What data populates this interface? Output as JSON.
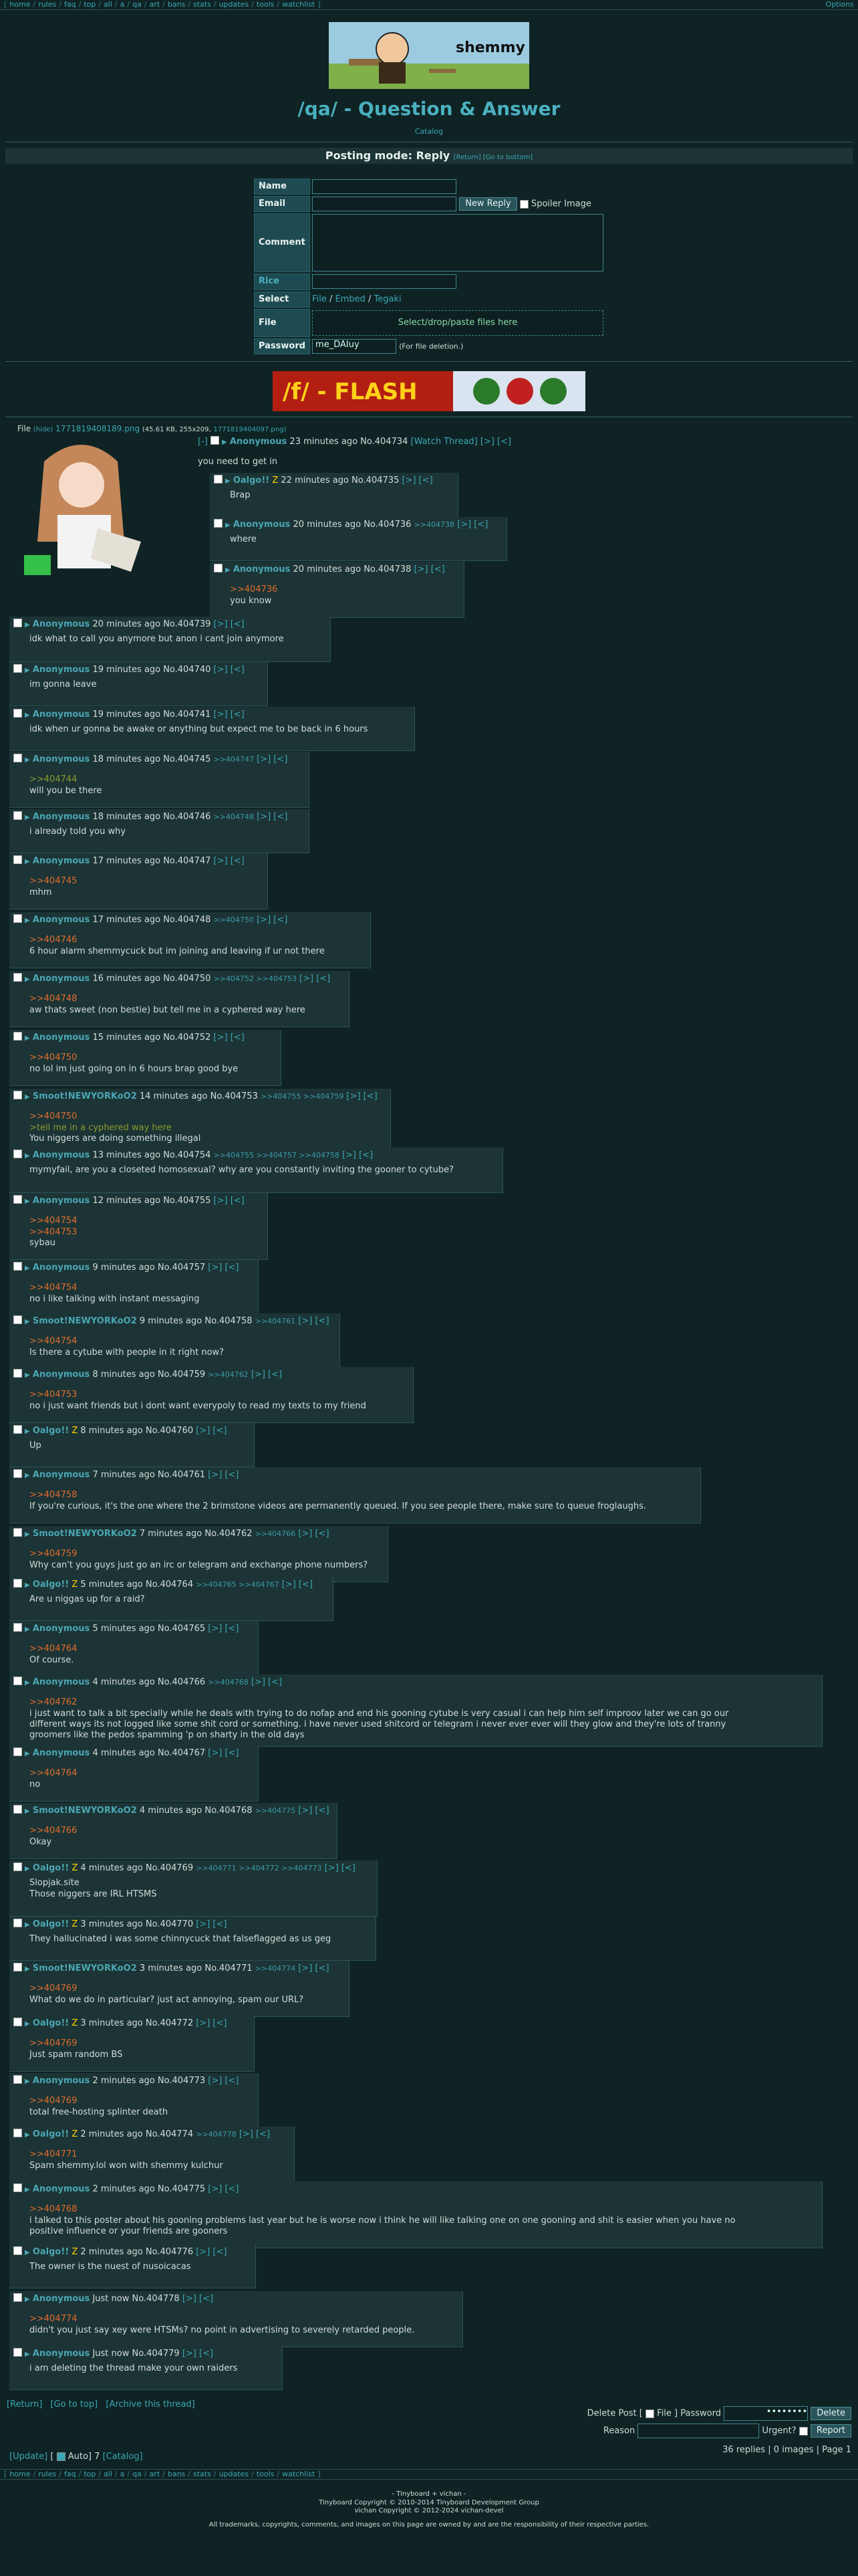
{
  "navbar": {
    "left": [
      "home",
      "rules",
      "faq",
      "top",
      "all",
      "a",
      "qa",
      "art",
      "bans",
      "stats",
      "updates",
      "tools",
      "watchlist"
    ],
    "right": "Options"
  },
  "banner": {
    "text": "shemmy"
  },
  "board": {
    "title": "/qa/ - Question & Answer",
    "catalog": "Catalog"
  },
  "posting_mode": {
    "label": "Posting mode: Reply",
    "return": "[Return]",
    "bottom": "[Go to bottom]"
  },
  "form": {
    "name_label": "Name",
    "email_label": "Email",
    "comment_label": "Comment",
    "rice_label": "Rice",
    "select_label": "Select",
    "file_label": "File",
    "password_label": "Password",
    "new_reply": "New Reply",
    "spoiler": "Spoiler Image",
    "select_options": [
      "File",
      "Embed",
      "Tegaki"
    ],
    "file_placeholder": "Select/drop/paste files here",
    "password_value": "me_DAIuy",
    "password_note": "(For file deletion.)"
  },
  "flash_banner": {
    "text": "/f/ - FLASH"
  },
  "op_file": {
    "label": "File",
    "hide": "(hide)",
    "name": "1771819408189.png",
    "meta": "(45.61 KB, 255x209,",
    "orig": "1771819404097.png)"
  },
  "op": {
    "name": "Anonymous",
    "time": "23 minutes ago",
    "no": "No.404734",
    "watch": "[Watch Thread]",
    "nav": "[>] [<]",
    "text": "you need to get in"
  },
  "posts": [
    {
      "name": "Oalgo!!",
      "cap": "Z",
      "time": "22 minutes ago",
      "no": "No.404735",
      "back": "",
      "lines": [
        [
          "",
          "Brap"
        ]
      ]
    },
    {
      "name": "Anonymous",
      "time": "20 minutes ago",
      "no": "No.404736",
      "back": ">>404738",
      "lines": [
        [
          "",
          "where"
        ]
      ]
    },
    {
      "name": "Anonymous",
      "time": "20 minutes ago",
      "no": "No.404738",
      "back": "",
      "lines": [
        [
          "q",
          ">>404736"
        ],
        [
          "",
          "you know"
        ]
      ]
    },
    {
      "name": "Anonymous",
      "time": "20 minutes ago",
      "no": "No.404739",
      "back": "",
      "lines": [
        [
          "",
          "idk what to call you anymore but anon i cant join anymore"
        ]
      ]
    },
    {
      "name": "Anonymous",
      "time": "19 minutes ago",
      "no": "No.404740",
      "back": "",
      "lines": [
        [
          "",
          "im gonna leave"
        ]
      ]
    },
    {
      "name": "Anonymous",
      "time": "19 minutes ago",
      "no": "No.404741",
      "back": "",
      "lines": [
        [
          "",
          "idk when ur gonna be awake or anything but expect me to be back in 6 hours"
        ]
      ]
    },
    {
      "name": "Anonymous",
      "time": "18 minutes ago",
      "no": "No.404745",
      "back": ">>404747",
      "lines": [
        [
          "g",
          ">>404744"
        ],
        [
          "",
          "will you be there"
        ]
      ]
    },
    {
      "name": "Anonymous",
      "time": "18 minutes ago",
      "no": "No.404746",
      "back": ">>404748",
      "lines": [
        [
          "",
          "i already told you why"
        ]
      ]
    },
    {
      "name": "Anonymous",
      "time": "17 minutes ago",
      "no": "No.404747",
      "back": "",
      "lines": [
        [
          "q",
          ">>404745"
        ],
        [
          "",
          "mhm"
        ]
      ]
    },
    {
      "name": "Anonymous",
      "time": "17 minutes ago",
      "no": "No.404748",
      "back": ">>404750",
      "lines": [
        [
          "q",
          ">>404746"
        ],
        [
          "",
          "6 hour alarm shemmycuck but im joining and leaving if ur not there"
        ]
      ]
    },
    {
      "name": "Anonymous",
      "time": "16 minutes ago",
      "no": "No.404750",
      "back": ">>404752 >>404753",
      "lines": [
        [
          "q",
          ">>404748"
        ],
        [
          "",
          "aw thats sweet (non bestie) but tell me in a cyphered way here"
        ]
      ]
    },
    {
      "name": "Anonymous",
      "time": "15 minutes ago",
      "no": "No.404752",
      "back": "",
      "lines": [
        [
          "q",
          ">>404750"
        ],
        [
          "",
          "no lol im just going on in 6 hours brap good bye"
        ]
      ]
    },
    {
      "name": "Smoot!NEWYORKoO2",
      "time": "14 minutes ago",
      "no": "No.404753",
      "back": ">>404755 >>404759",
      "lines": [
        [
          "q",
          ">>404750"
        ],
        [
          "g",
          ">tell me in a cyphered way here"
        ],
        [
          "",
          "You niggers are doing something illegal"
        ]
      ]
    },
    {
      "name": "Anonymous",
      "time": "13 minutes ago",
      "no": "No.404754",
      "back": ">>404755 >>404757 >>404758",
      "lines": [
        [
          "",
          "mymyfail, are you a closeted homosexual? why are you constantly inviting the gooner to cytube?"
        ]
      ]
    },
    {
      "name": "Anonymous",
      "time": "12 minutes ago",
      "no": "No.404755",
      "back": "",
      "lines": [
        [
          "q",
          ">>404754"
        ],
        [
          "q",
          ">>404753"
        ],
        [
          "",
          "sybau"
        ]
      ]
    },
    {
      "name": "Anonymous",
      "time": "9 minutes ago",
      "no": "No.404757",
      "back": "",
      "lines": [
        [
          "q",
          ">>404754"
        ],
        [
          "",
          "no i like talking with instant messaging"
        ]
      ]
    },
    {
      "name": "Smoot!NEWYORKoO2",
      "time": "9 minutes ago",
      "no": "No.404758",
      "back": ">>404761",
      "lines": [
        [
          "q",
          ">>404754"
        ],
        [
          "",
          "Is there a cytube with people in it right now?"
        ]
      ]
    },
    {
      "name": "Anonymous",
      "time": "8 minutes ago",
      "no": "No.404759",
      "back": ">>404762",
      "lines": [
        [
          "q",
          ">>404753"
        ],
        [
          "",
          "no i just want friends but i dont want everypoly to read my texts to my friend"
        ]
      ]
    },
    {
      "name": "Oalgo!!",
      "cap": "Z",
      "time": "8 minutes ago",
      "no": "No.404760",
      "back": "",
      "lines": [
        [
          "",
          "Up"
        ]
      ]
    },
    {
      "name": "Anonymous",
      "time": "7 minutes ago",
      "no": "No.404761",
      "back": "",
      "lines": [
        [
          "q",
          ">>404758"
        ],
        [
          "",
          "If you're curious, it's the one where the 2 brimstone videos are permanently queued. If you see people there, make sure to queue froglaughs."
        ]
      ]
    },
    {
      "name": "Smoot!NEWYORKoO2",
      "time": "7 minutes ago",
      "no": "No.404762",
      "back": ">>404766",
      "lines": [
        [
          "q",
          ">>404759"
        ],
        [
          "",
          "Why can't you guys just go an irc or telegram and exchange phone numbers?"
        ]
      ]
    },
    {
      "name": "Oalgo!!",
      "cap": "Z",
      "time": "5 minutes ago",
      "no": "No.404764",
      "back": ">>404765 >>404767",
      "lines": [
        [
          "",
          "Are u niggas up for a raid?"
        ]
      ]
    },
    {
      "name": "Anonymous",
      "time": "5 minutes ago",
      "no": "No.404765",
      "back": "",
      "lines": [
        [
          "q",
          ">>404764"
        ],
        [
          "",
          "Of course."
        ]
      ]
    },
    {
      "name": "Anonymous",
      "time": "4 minutes ago",
      "no": "No.404766",
      "back": ">>404768",
      "lines": [
        [
          "q",
          ">>404762"
        ],
        [
          "",
          "i just want to talk a bit specially while he deals with trying to do nofap and end his gooning cytube is very casual i can help him self improov later we can go our"
        ],
        [
          "",
          "different ways its not logged like some shit cord or something. i have never used shitcord or telegram i never ever ever will they glow and they're lots of tranny"
        ],
        [
          "",
          "groomers like the pedos spamming 'p on sharty in the old days"
        ]
      ]
    },
    {
      "name": "Anonymous",
      "time": "4 minutes ago",
      "no": "No.404767",
      "back": "",
      "lines": [
        [
          "q",
          ">>404764"
        ],
        [
          "",
          "no"
        ]
      ]
    },
    {
      "name": "Smoot!NEWYORKoO2",
      "time": "4 minutes ago",
      "no": "No.404768",
      "back": ">>404775",
      "lines": [
        [
          "q",
          ">>404766"
        ],
        [
          "",
          "Okay"
        ]
      ]
    },
    {
      "name": "Oalgo!!",
      "cap": "Z",
      "time": "4 minutes ago",
      "no": "No.404769",
      "back": ">>404771 >>404772 >>404773",
      "lines": [
        [
          "",
          "Slopjak.site"
        ],
        [
          "",
          "Those niggers are IRL HTSMS"
        ]
      ]
    },
    {
      "name": "Oalgo!!",
      "cap": "Z",
      "time": "3 minutes ago",
      "no": "No.404770",
      "back": "",
      "lines": [
        [
          "",
          "They hallucinated i was some chinnycuck that falseflagged as us geg"
        ]
      ]
    },
    {
      "name": "Smoot!NEWYORKoO2",
      "time": "3 minutes ago",
      "no": "No.404771",
      "back": ">>404774",
      "lines": [
        [
          "q",
          ">>404769"
        ],
        [
          "",
          "What do we do in particular? just act annoying, spam our URL?"
        ]
      ]
    },
    {
      "name": "Oalgo!!",
      "cap": "Z",
      "time": "3 minutes ago",
      "no": "No.404772",
      "back": "",
      "lines": [
        [
          "q",
          ">>404769"
        ],
        [
          "",
          "Just spam random BS"
        ]
      ]
    },
    {
      "name": "Anonymous",
      "time": "2 minutes ago",
      "no": "No.404773",
      "back": "",
      "lines": [
        [
          "q",
          ">>404769"
        ],
        [
          "",
          "total free-hosting splinter death"
        ]
      ]
    },
    {
      "name": "Oalgo!!",
      "cap": "Z",
      "time": "2 minutes ago",
      "no": "No.404774",
      "back": ">>404778",
      "lines": [
        [
          "q",
          ">>404771"
        ],
        [
          "",
          "Spam shemmy.lol won with shemmy kulchur"
        ]
      ]
    },
    {
      "name": "Anonymous",
      "time": "2 minutes ago",
      "no": "No.404775",
      "back": "",
      "lines": [
        [
          "q",
          ">>404768"
        ],
        [
          "",
          "i talked to this poster about his gooning problems last year but he is worse now i think he will like talking one on one gooning and shit is easier when you have no"
        ],
        [
          "",
          "positive influence or your friends are gooners"
        ]
      ]
    },
    {
      "name": "Oalgo!!",
      "cap": "Z",
      "time": "2 minutes ago",
      "no": "No.404776",
      "back": "",
      "lines": [
        [
          "",
          "The owner is the nuest of nusoicacas"
        ]
      ]
    },
    {
      "name": "Anonymous",
      "time": "Just now",
      "no": "No.404778",
      "back": "",
      "lines": [
        [
          "q",
          ">>404774"
        ],
        [
          "",
          "didn't you just say xey were HTSMs? no point in advertising to severely retarded people."
        ]
      ]
    },
    {
      "name": "Anonymous",
      "time": "Just now",
      "no": "No.404779",
      "back": "",
      "lines": [
        [
          "",
          "i am deleting the thread make your own raiders"
        ]
      ]
    }
  ],
  "post_nav": "[>] [<]",
  "bottom": {
    "return": "[Return]",
    "top": "[Go to top]",
    "archive": "[Archive this thread]",
    "delete_post": "Delete Post [",
    "file": "File ]",
    "password": "Password",
    "password_value": "••••••••",
    "delete_btn": "Delete",
    "reason": "Reason",
    "urgent": "Urgent?",
    "report_btn": "Report",
    "stats": "36 replies | 0 images | Page 1",
    "update": "[Update]",
    "auto": "Auto]",
    "auto_count": "7",
    "catalog": "[Catalog]"
  },
  "footer": {
    "l1": "- Tinyboard + vichan -",
    "l2": "Tinyboard Copyright © 2010-2014 Tinyboard Development Group",
    "l3": "vichan Copyright © 2012-2024 vichan-devel",
    "l4": "All trademarks, copyrights, comments, and images on this page are owned by and are the responsibility of their respective parties."
  }
}
